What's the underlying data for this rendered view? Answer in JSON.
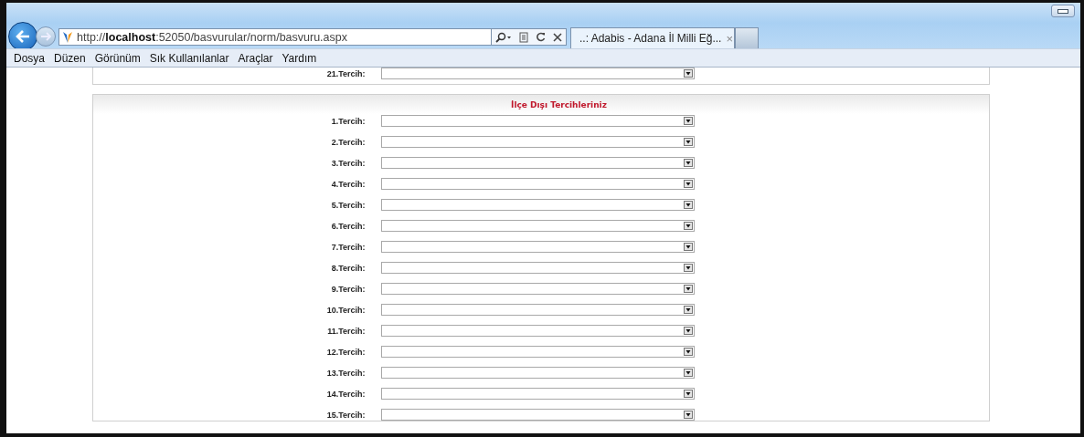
{
  "browser": {
    "address": "http://**localhost**:52050/basvurular/norm/basvuru.aspx",
    "tabs": [
      {
        "title": "..: Adabis - Adana İl Milli Eğ...",
        "close": "×",
        "selected": true
      }
    ]
  },
  "menu": [
    "Dosya",
    "Düzen",
    "Görünüm",
    "Sık Kullanılanlar",
    "Araçlar",
    "Yardım"
  ],
  "previous_section": {
    "rows": [
      {
        "label": "21.Tercih:"
      }
    ]
  },
  "section": {
    "title": "İlçe Dışı Tercihleriniz",
    "rows": [
      {
        "label": "1.Tercih:"
      },
      {
        "label": "2.Tercih:"
      },
      {
        "label": "3.Tercih:"
      },
      {
        "label": "4.Tercih:"
      },
      {
        "label": "5.Tercih:"
      },
      {
        "label": "6.Tercih:"
      },
      {
        "label": "7.Tercih:"
      },
      {
        "label": "8.Tercih:"
      },
      {
        "label": "9.Tercih:"
      },
      {
        "label": "10.Tercih:"
      },
      {
        "label": "11.Tercih:"
      },
      {
        "label": "12.Tercih:"
      },
      {
        "label": "13.Tercih:"
      },
      {
        "label": "14.Tercih:"
      },
      {
        "label": "15.Tercih:"
      }
    ]
  }
}
